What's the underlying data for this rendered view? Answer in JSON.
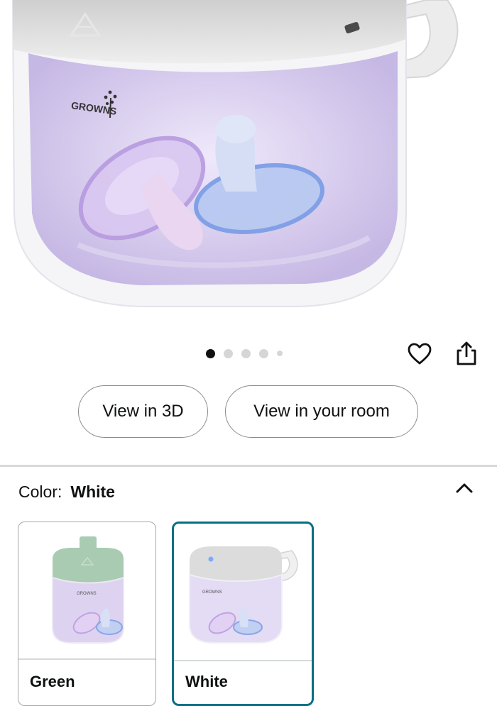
{
  "product": {
    "brand_mark": "GROWNS",
    "image_count": 5,
    "active_image_index": 0
  },
  "actions": {
    "wishlist_icon": "heart-icon",
    "share_icon": "share-icon"
  },
  "buttons": {
    "view_3d": "View in 3D",
    "view_room": "View in your room"
  },
  "color_selector": {
    "label": "Color:",
    "selected": "White",
    "collapse_icon": "chevron-up-icon",
    "options": [
      {
        "name": "Green",
        "accent": "#a9cbb2",
        "selected": false
      },
      {
        "name": "White",
        "accent": "#e8e8e8",
        "selected": true
      }
    ]
  },
  "colors": {
    "selected_border": "#007185",
    "text": "#0f1111",
    "divider": "#d5d9d9"
  }
}
